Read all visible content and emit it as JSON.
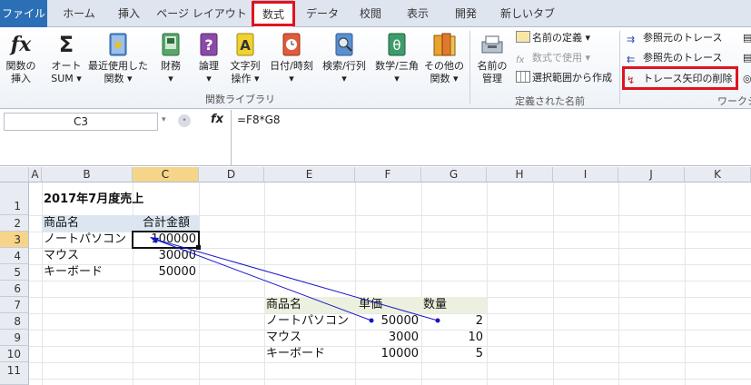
{
  "tabs": [
    "ファイル",
    "ホーム",
    "挿入",
    "ページ レイアウト",
    "数式",
    "データ",
    "校閲",
    "表示",
    "開発",
    "新しいタブ"
  ],
  "ribbon": {
    "function_library": {
      "insert_function": "関数の\n挿入",
      "autosum": "オート\nSUM ▾",
      "recent": "最近使用した\n関数 ▾",
      "financial": "財務\n▾",
      "logical": "論理\n▾",
      "text": "文字列\n操作 ▾",
      "datetime": "日付/時刻\n▾",
      "lookup": "検索/行列\n▾",
      "math": "数学/三角\n▾",
      "more": "その他の\n関数 ▾",
      "group_label": "関数ライブラリ"
    },
    "defined_names": {
      "name_manager": "名前の\n管理",
      "define_name": "名前の定義 ▾",
      "use_in_formula": "数式で使用 ▾",
      "create_from_selection": "選択範囲から作成",
      "group_label": "定義された名前"
    },
    "auditing": {
      "trace_precedents": "参照元のトレース",
      "trace_dependents": "参照先のトレース",
      "remove_arrows": "トレース矢印の削除",
      "group_label": "ワークシ"
    }
  },
  "formula_bar": {
    "name_box": "C3",
    "fx": "fx",
    "formula": "=F8*G8"
  },
  "columns": [
    "A",
    "B",
    "C",
    "D",
    "E",
    "F",
    "G",
    "H",
    "I",
    "J",
    "K"
  ],
  "rows": [
    "1",
    "2",
    "3",
    "4",
    "5",
    "6",
    "7",
    "8",
    "9",
    "10",
    "11"
  ],
  "sheet": {
    "title": "2017年7月度売上",
    "summary_header": {
      "product": "商品名",
      "total": "合計金額"
    },
    "summary_rows": [
      {
        "product": "ノートパソコン",
        "total": "100000"
      },
      {
        "product": "マウス",
        "total": "30000"
      },
      {
        "product": "キーボード",
        "total": "50000"
      }
    ],
    "detail_header": {
      "product": "商品名",
      "price": "単価",
      "qty": "数量"
    },
    "detail_rows": [
      {
        "product": "ノートパソコン",
        "price": "50000",
        "qty": "2"
      },
      {
        "product": "マウス",
        "price": "3000",
        "qty": "10"
      },
      {
        "product": "キーボード",
        "price": "10000",
        "qty": "5"
      }
    ]
  },
  "colors": {
    "highlight": "#e0141e",
    "arrow": "#1414c8",
    "header_fill": "#dce6f1",
    "detail_fill": "#ebf1de",
    "selected_header": "#f6d58a"
  }
}
